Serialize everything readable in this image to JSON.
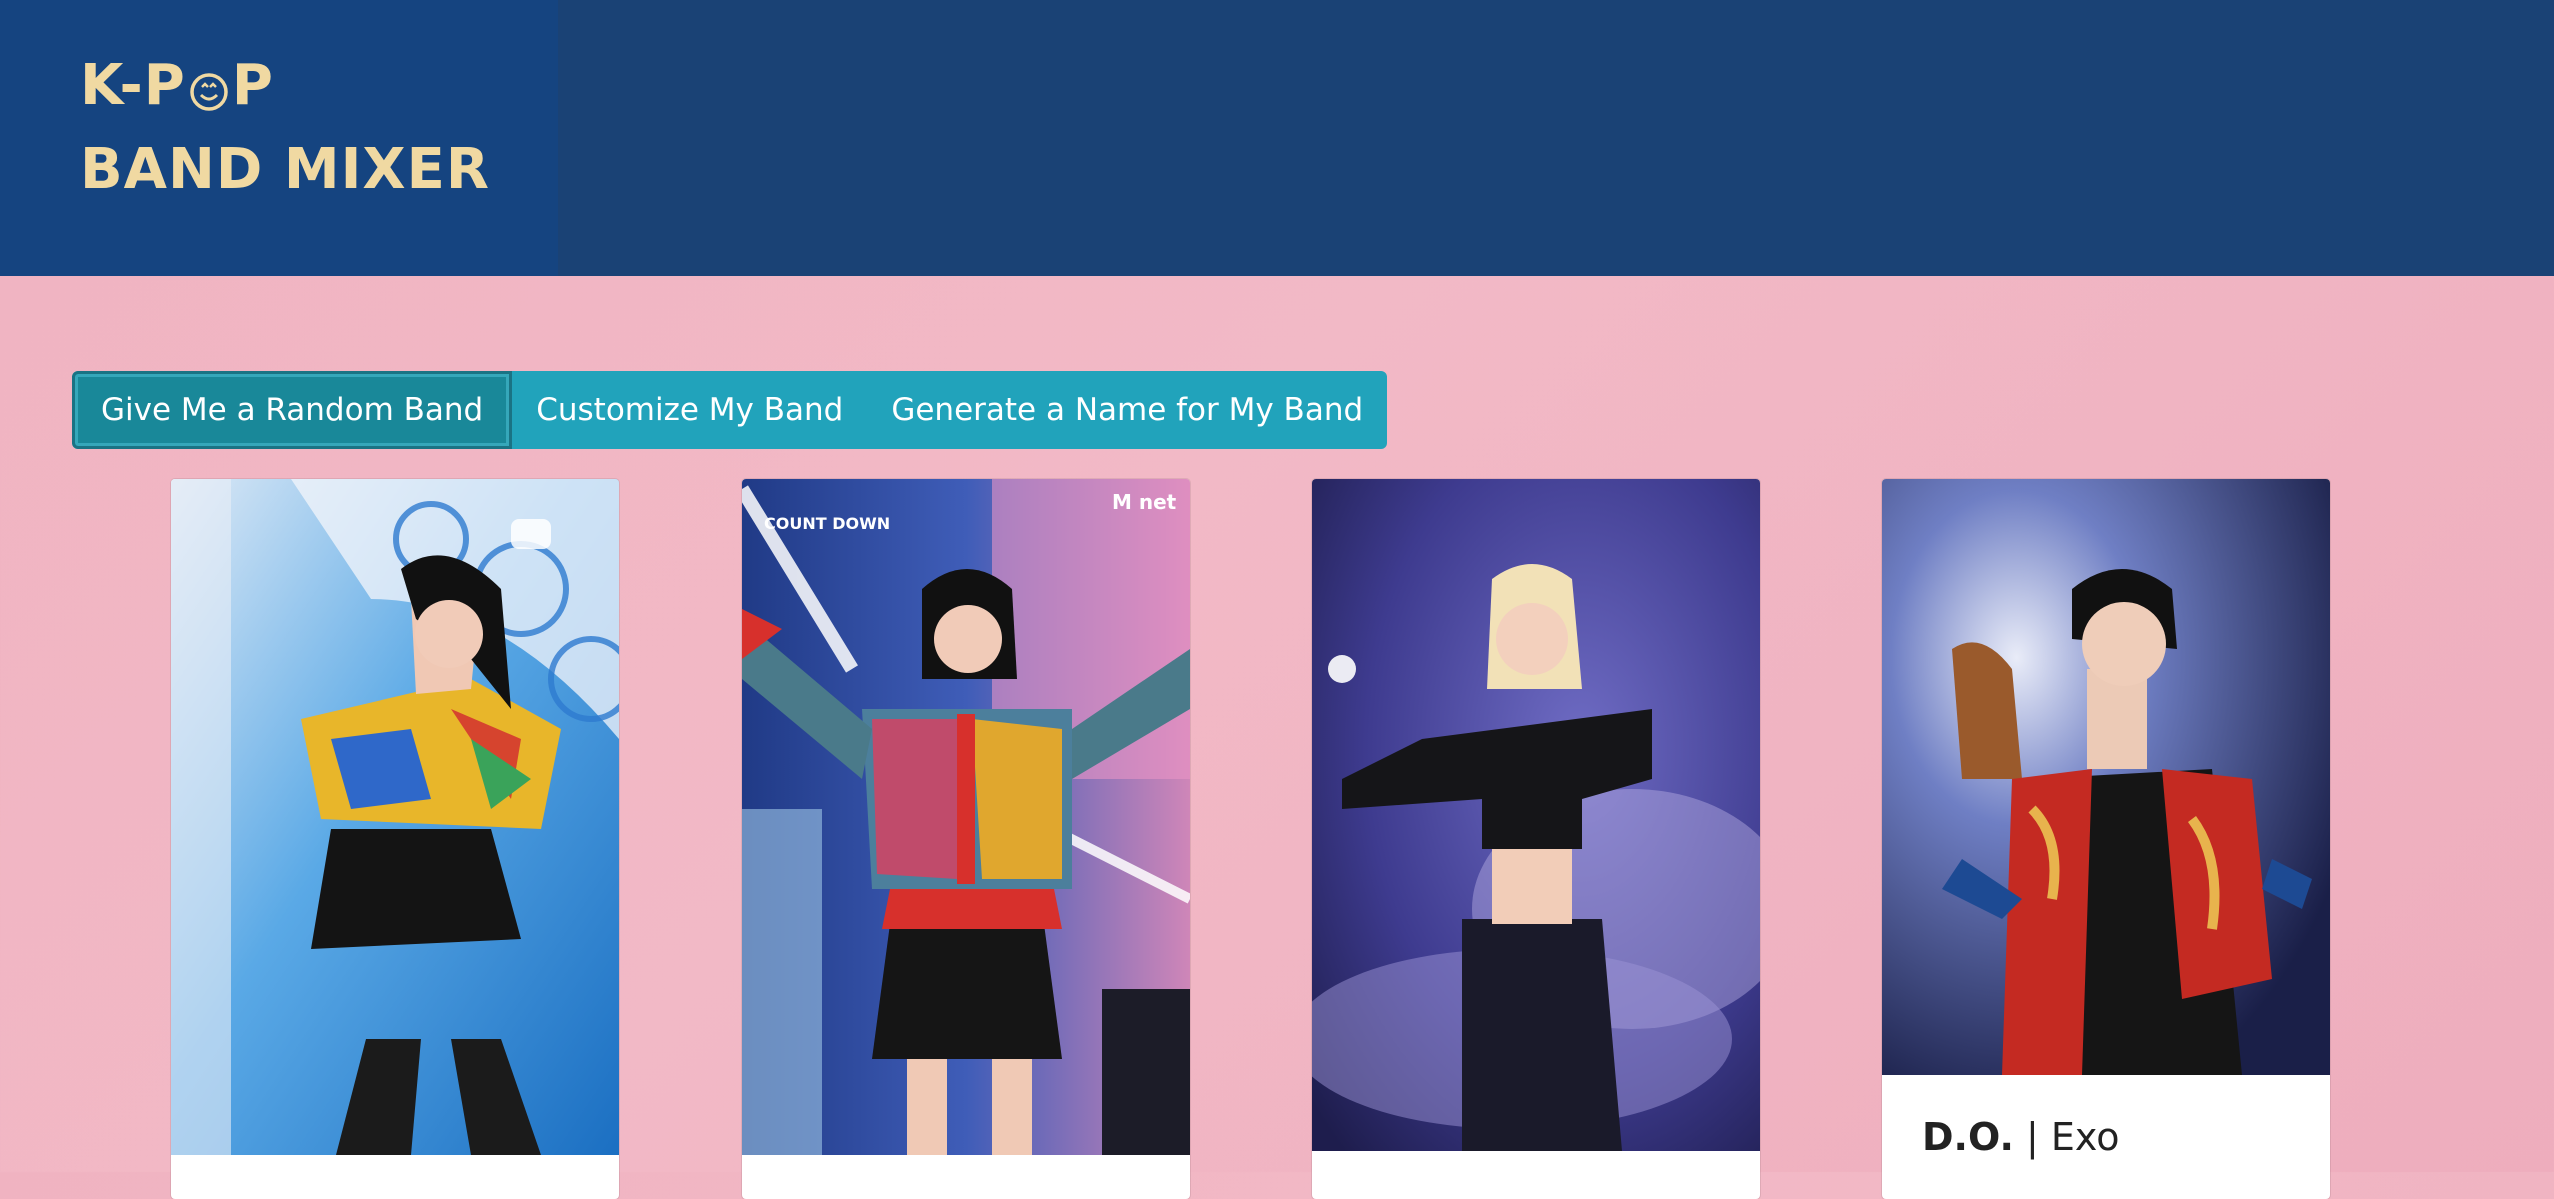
{
  "logo": {
    "line1_a": "K-P",
    "line1_b": "P",
    "line2": "BAND MIXER"
  },
  "toolbar": {
    "random_label": "Give Me a Random Band",
    "customize_label": "Customize My Band",
    "name_label": "Generate a Name for My Band"
  },
  "cards": [
    {
      "name": "",
      "group": ""
    },
    {
      "name": "",
      "group": ""
    },
    {
      "name": "",
      "group": ""
    },
    {
      "name": "D.O.",
      "separator": "|",
      "group": "Exo"
    }
  ],
  "photo_marks": {
    "card2_logo": "M net",
    "card2_show": "COUNT DOWN"
  }
}
